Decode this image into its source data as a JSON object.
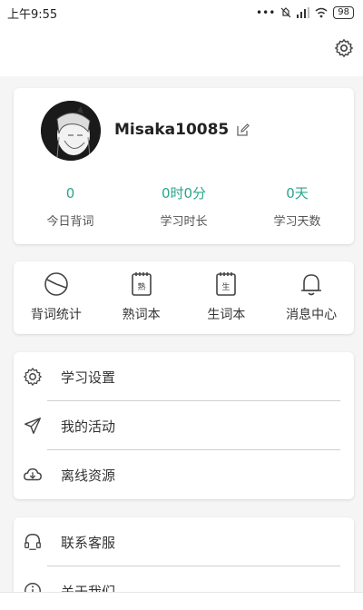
{
  "status_bar": {
    "time": "上午9:55",
    "battery": "98",
    "signal_dots": "•••"
  },
  "profile": {
    "username": "Misaka10085",
    "stats": [
      {
        "value": "0",
        "label": "今日背词"
      },
      {
        "value": "0时0分",
        "label": "学习时长"
      },
      {
        "value": "0天",
        "label": "学习天数"
      }
    ]
  },
  "shortcuts": [
    {
      "label": "背词统计",
      "icon": "pie-chart-icon"
    },
    {
      "label": "熟词本",
      "icon": "familiar-words-book-icon",
      "glyph": "熟"
    },
    {
      "label": "生词本",
      "icon": "new-words-book-icon",
      "glyph": "生"
    },
    {
      "label": "消息中心",
      "icon": "bell-icon"
    }
  ],
  "menu1": [
    {
      "label": "学习设置",
      "icon": "gear-icon"
    },
    {
      "label": "我的活动",
      "icon": "send-icon"
    },
    {
      "label": "离线资源",
      "icon": "cloud-download-icon"
    }
  ],
  "menu2": [
    {
      "label": "联系客服",
      "icon": "headset-icon"
    },
    {
      "label": "关于我们",
      "icon": "info-icon"
    }
  ],
  "colors": {
    "accent": "#2aa58a",
    "background": "#f5f5f5",
    "card": "#ffffff"
  }
}
